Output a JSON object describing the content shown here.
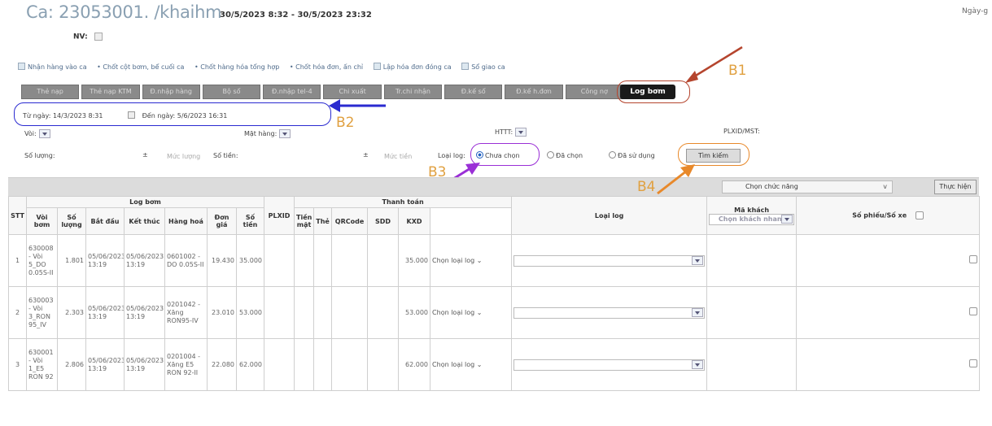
{
  "header": {
    "title": "Ca: 23053001. /khaihm",
    "time_range": "30/5/2023 8:32 - 30/5/2023 23:32",
    "top_right": "Ngày-g",
    "nv_label": "NV:"
  },
  "actions": [
    "Nhận hàng vào ca",
    "• Chốt cột bơm, bể cuối ca",
    "• Chốt hàng hóa tổng hợp",
    "• Chốt hóa đơn, ấn chỉ",
    "Lập hóa đơn đóng ca",
    "Sổ giao ca"
  ],
  "tabs": [
    "Thẻ nạp",
    "Thẻ nạp KTM",
    "Đ.nhập hàng",
    "Bộ sổ",
    "Đ.nhập tel-4",
    "Chi xuất",
    "Tr.chi nhận",
    "Đ.kế sổ",
    "Đ.kế h.đơn",
    "Công nợ"
  ],
  "active_tab": "Log bơm",
  "annotations": {
    "b1": "B1",
    "b2": "B2",
    "b3": "B3",
    "b4": "B4"
  },
  "date_filter": {
    "from_label": "Từ ngày:",
    "from_value": "14/3/2023 8:31",
    "to_label": "Đến ngày:",
    "to_value": "5/6/2023 16:31"
  },
  "filters": {
    "voi_label": "Vòi:",
    "mat_hang_label": "Mặt hàng:",
    "httt_label": "HTTT:",
    "plxid_label": "PLXID/MST:",
    "so_luong_label": "Số lượng:",
    "plus_minus": "±",
    "muc_luong_placeholder": "Mức lượng",
    "so_tien_label": "Số tiền:",
    "muc_tien_placeholder": "Mức tiền",
    "loai_log_label": "Loại log:",
    "radio_chua_chon": "Chưa chọn",
    "radio_da_chon": "Đã chọn",
    "radio_da_su_dung": "Đã sử dụng",
    "search_button": "Tìm kiếm"
  },
  "toolbar": {
    "chon_chuc_nang": "Chọn chức năng",
    "thuc_hien": "Thực hiện"
  },
  "table": {
    "group_headers": {
      "log_bom": "Log bơm",
      "thanh_toan": "Thanh toán"
    },
    "headers": {
      "stt": "STT",
      "voi_bom": "Vòi bơm",
      "so_luong": "Số lượng",
      "bat_dau": "Bắt đầu",
      "ket_thuc": "Kết thúc",
      "hang_hoa": "Hàng hoá",
      "don_gia": "Đơn giá",
      "so_tien": "Số tiền",
      "plxid": "PLXID",
      "tien_mat": "Tiền mặt",
      "the": "Thẻ",
      "qrcode": "QRCode",
      "sdd": "SDD",
      "kxd": "KXD",
      "loai_log": "Loại log",
      "ma_khach": "Mã khách",
      "ma_khach_placeholder": "Chọn khách nhanh",
      "so_phieu": "Số phiếu/Số xe"
    },
    "rows": [
      {
        "stt": "1",
        "voi": "630008 - Vòi 5_DO 0.05S-II",
        "so_luong": "1.801",
        "bat_dau": "05/06/2023 13:19",
        "ket_thuc": "05/06/2023 13:19",
        "hang_hoa": "0601002 - DO 0.05S-II",
        "don_gia": "19.430",
        "so_tien": "35.000",
        "kxd": "35.000",
        "loai_log": "Chọn loại log"
      },
      {
        "stt": "2",
        "voi": "630003 - Vòi 3_RON 95_IV",
        "so_luong": "2.303",
        "bat_dau": "05/06/2023 13:19",
        "ket_thuc": "05/06/2023 13:19",
        "hang_hoa": "0201042 - Xăng RON95-IV",
        "don_gia": "23.010",
        "so_tien": "53.000",
        "kxd": "53.000",
        "loai_log": "Chọn loại log"
      },
      {
        "stt": "3",
        "voi": "630001 - Vòi 1_E5 RON 92",
        "so_luong": "2.806",
        "bat_dau": "05/06/2023 13:19",
        "ket_thuc": "05/06/2023 13:19",
        "hang_hoa": "0201004 - Xăng E5 RON 92-II",
        "don_gia": "22.080",
        "so_tien": "62.000",
        "kxd": "62.000",
        "loai_log": "Chọn loại log"
      }
    ]
  },
  "colors": {
    "b1": "#b5452e",
    "b2": "#2a2ad0",
    "b3": "#9a2fd6",
    "b4": "#e8892b",
    "label": "#e0a040"
  }
}
